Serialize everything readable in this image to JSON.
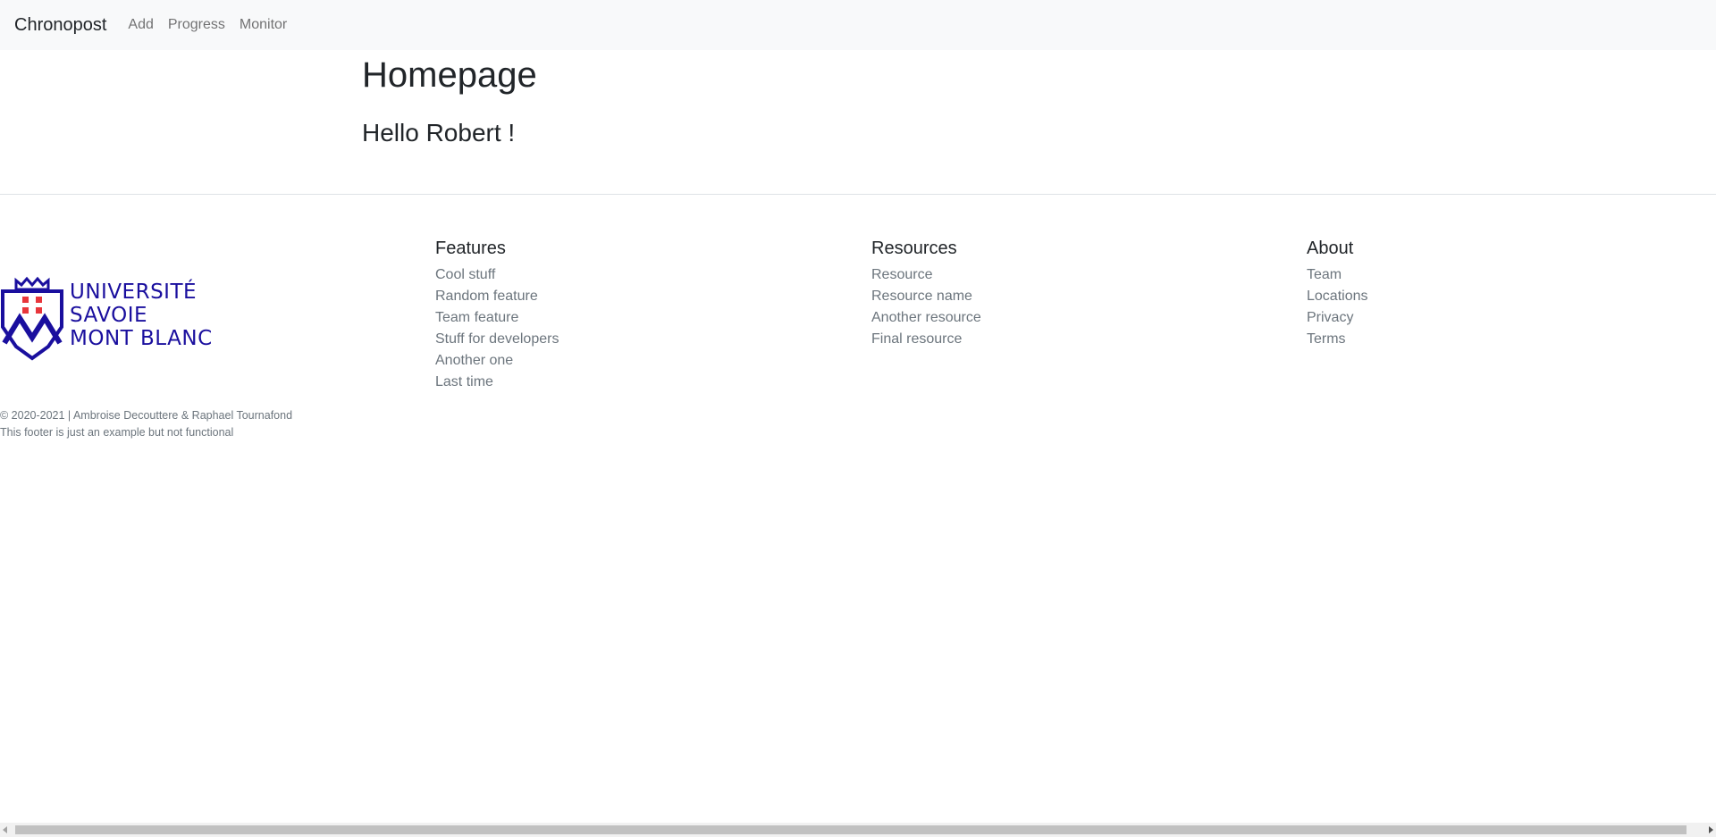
{
  "navbar": {
    "brand": "Chronopost",
    "links": [
      "Add",
      "Progress",
      "Monitor"
    ]
  },
  "main": {
    "title": "Homepage",
    "greeting": "Hello Robert !"
  },
  "footer": {
    "logo_lines": [
      "UNIVERSITÉ",
      "SAVOIE",
      "MONT BLANC"
    ],
    "copyright": "© 2020-2021 | Ambroise Decouttere & Raphael Tournafond",
    "note": "This footer is just an example but not functional",
    "columns": [
      {
        "heading": "Features",
        "links": [
          "Cool stuff",
          "Random feature",
          "Team feature",
          "Stuff for developers",
          "Another one",
          "Last time"
        ]
      },
      {
        "heading": "Resources",
        "links": [
          "Resource",
          "Resource name",
          "Another resource",
          "Final resource"
        ]
      },
      {
        "heading": "About",
        "links": [
          "Team",
          "Locations",
          "Privacy",
          "Terms"
        ]
      }
    ]
  },
  "colors": {
    "navbar_bg": "#f8f9fa",
    "logo_blue": "#1a0f9e",
    "logo_red": "#e8363b",
    "muted_text": "#6c757d"
  }
}
